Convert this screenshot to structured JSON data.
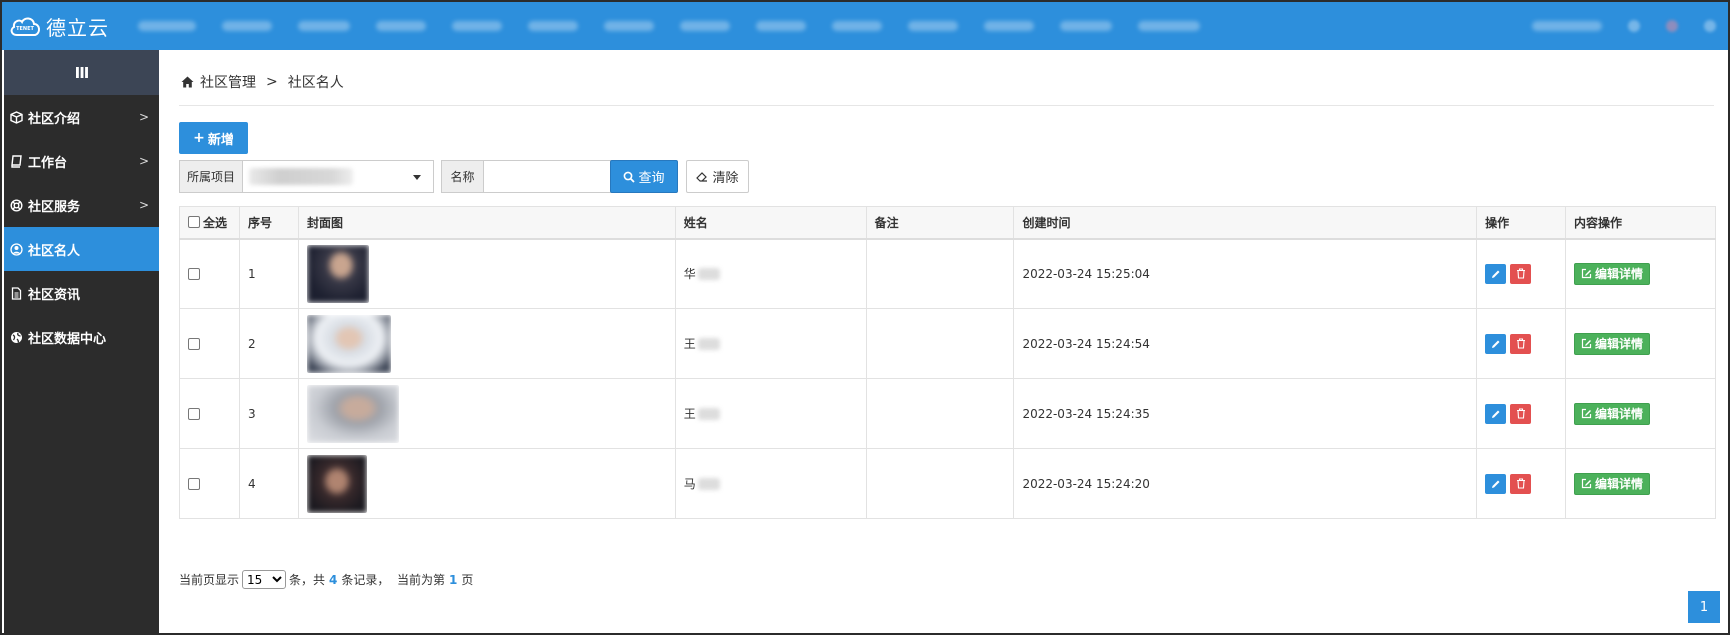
{
  "app": {
    "logo_text": "德立云",
    "logo_badge": "TENET"
  },
  "sidebar": {
    "toggle": "III",
    "items": [
      {
        "label": "社区介绍",
        "icon": "cube-icon",
        "has_arrow": true,
        "active": false
      },
      {
        "label": "工作台",
        "icon": "book-icon",
        "has_arrow": true,
        "active": false
      },
      {
        "label": "社区服务",
        "icon": "lifebuoy-icon",
        "has_arrow": true,
        "active": false
      },
      {
        "label": "社区名人",
        "icon": "user-circle-icon",
        "has_arrow": false,
        "active": true
      },
      {
        "label": "社区资讯",
        "icon": "document-icon",
        "has_arrow": false,
        "active": false
      },
      {
        "label": "社区数据中心",
        "icon": "globe-icon",
        "has_arrow": false,
        "active": false
      }
    ]
  },
  "breadcrumb": {
    "root": "社区管理",
    "separator": ">",
    "current": "社区名人"
  },
  "toolbar": {
    "add_label": "新增"
  },
  "filters": {
    "project_label": "所属项目",
    "name_label": "名称",
    "name_value": "",
    "query_label": "查询",
    "clear_label": "清除"
  },
  "table": {
    "headers": {
      "select_all": "全选",
      "index": "序号",
      "cover": "封面图",
      "name": "姓名",
      "remark": "备注",
      "created": "创建时间",
      "actions": "操作",
      "content_actions": "内容操作"
    },
    "detail_label": "编辑详情",
    "rows": [
      {
        "index": "1",
        "name": "华",
        "remark": "",
        "created": "2022-03-24 15:25:04"
      },
      {
        "index": "2",
        "name": "王",
        "remark": "",
        "created": "2022-03-24 15:24:54"
      },
      {
        "index": "3",
        "name": "王",
        "remark": "",
        "created": "2022-03-24 15:24:35"
      },
      {
        "index": "4",
        "name": "马",
        "remark": "",
        "created": "2022-03-24 15:24:20"
      }
    ]
  },
  "footer": {
    "prefix": "当前页显示",
    "page_size": "15",
    "middle1": "条，共",
    "total": "4",
    "middle2": "条记录，  当前为第",
    "current_page": "1",
    "suffix": "页"
  },
  "pager": {
    "page": "1"
  },
  "colors": {
    "primary": "#2d8fdc",
    "danger": "#e35050",
    "success": "#4cb15b",
    "sidebar": "#2c2c2c"
  }
}
